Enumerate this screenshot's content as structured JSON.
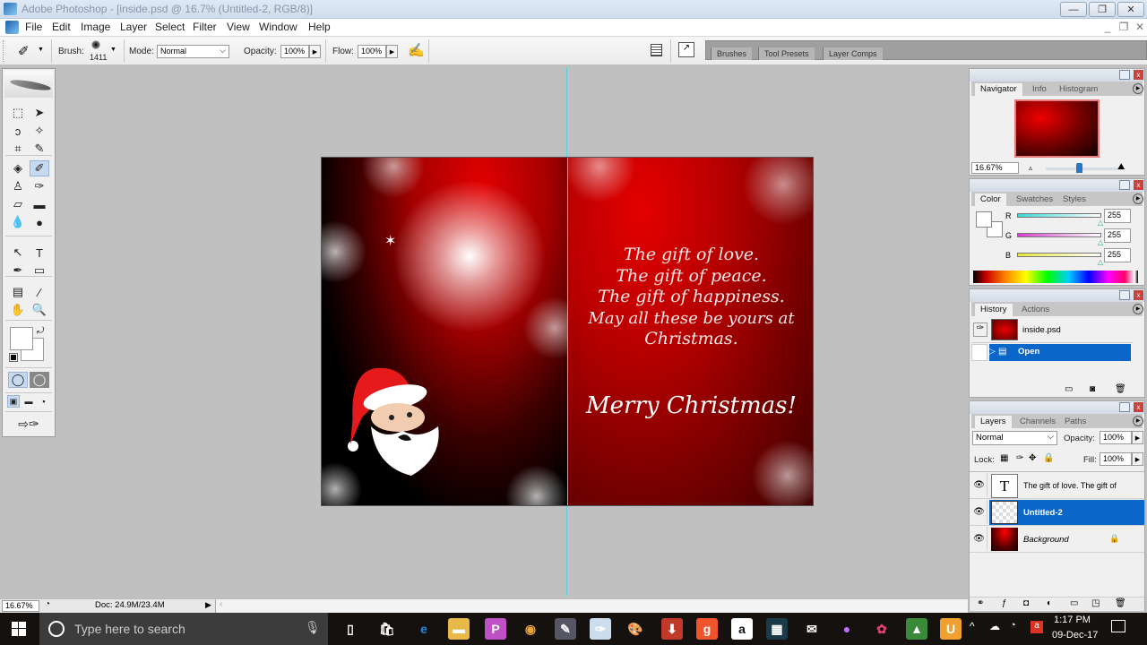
{
  "window": {
    "title": "Adobe Photoshop - [inside.psd @ 16.7% (Untitled-2, RGB/8)]",
    "minimize_glyph": "—",
    "restore_glyph": "❐",
    "close_glyph": "✕"
  },
  "menu": {
    "items": [
      "File",
      "Edit",
      "Image",
      "Layer",
      "Select",
      "Filter",
      "View",
      "Window",
      "Help"
    ],
    "doc_controls": [
      "_",
      "❐",
      "✕"
    ]
  },
  "options": {
    "brush_label": "Brush:",
    "brush_size": "1411",
    "mode_label": "Mode:",
    "mode_value": "Normal",
    "opacity_label": "Opacity:",
    "opacity_value": "100%",
    "flow_label": "Flow:",
    "flow_value": "100%",
    "well_tabs": [
      "Brushes",
      "Tool Presets",
      "Layer Comps"
    ]
  },
  "toolbox": {
    "tools": [
      {
        "name": "marquee-tool",
        "glyph": "⬚"
      },
      {
        "name": "move-tool",
        "glyph": "➤"
      },
      {
        "name": "lasso-tool",
        "glyph": "ↄ"
      },
      {
        "name": "magic-wand-tool",
        "glyph": "✧"
      },
      {
        "name": "crop-tool",
        "glyph": "⌗"
      },
      {
        "name": "slice-tool",
        "glyph": "✎"
      },
      {
        "name": "healing-brush-tool",
        "glyph": "◈"
      },
      {
        "name": "brush-tool",
        "glyph": "✐"
      },
      {
        "name": "clone-stamp-tool",
        "glyph": "♙"
      },
      {
        "name": "history-brush-tool",
        "glyph": "✑"
      },
      {
        "name": "eraser-tool",
        "glyph": "▱"
      },
      {
        "name": "gradient-tool",
        "glyph": "▬"
      },
      {
        "name": "blur-tool",
        "glyph": "💧"
      },
      {
        "name": "dodge-tool",
        "glyph": "●"
      },
      {
        "name": "path-selection-tool",
        "glyph": "↖"
      },
      {
        "name": "type-tool",
        "glyph": "T"
      },
      {
        "name": "pen-tool",
        "glyph": "✒"
      },
      {
        "name": "shape-tool",
        "glyph": "▭"
      },
      {
        "name": "notes-tool",
        "glyph": "▤"
      },
      {
        "name": "eyedropper-tool",
        "glyph": "⁄"
      },
      {
        "name": "hand-tool",
        "glyph": "✋"
      },
      {
        "name": "zoom-tool",
        "glyph": "🔍"
      }
    ]
  },
  "document": {
    "poem_lines": [
      "The gift of love.",
      "The gift of peace.",
      "The gift of happiness.",
      "May all these be yours at",
      "Christmas."
    ],
    "greeting": "Merry Christmas!"
  },
  "navigator": {
    "tabs": [
      "Navigator",
      "Info",
      "Histogram"
    ],
    "zoom_value": "16.67%",
    "slider_position_fraction": 0.4
  },
  "color": {
    "tabs": [
      "Color",
      "Swatches",
      "Styles"
    ],
    "channels": [
      {
        "label": "R",
        "value": "255",
        "color": "#3fd6d6"
      },
      {
        "label": "G",
        "value": "255",
        "color": "#d63fd0"
      },
      {
        "label": "B",
        "value": "255",
        "color": "#e6e63f"
      }
    ]
  },
  "history": {
    "tabs": [
      "History",
      "Actions"
    ],
    "snapshot": "inside.psd",
    "states": [
      {
        "label": "Open",
        "selected": true
      }
    ]
  },
  "layers": {
    "tabs": [
      "Layers",
      "Channels",
      "Paths"
    ],
    "blend_mode": "Normal",
    "opacity_label": "Opacity:",
    "opacity_value": "100%",
    "lock_label": "Lock:",
    "fill_label": "Fill:",
    "fill_value": "100%",
    "items": [
      {
        "name": "The gift of love. The gift of",
        "type": "text",
        "visible": true,
        "selected": false,
        "locked": false
      },
      {
        "name": "Untitled-2",
        "type": "pixel",
        "visible": true,
        "selected": true,
        "locked": false
      },
      {
        "name": "Background",
        "type": "background",
        "visible": true,
        "selected": false,
        "locked": true
      }
    ]
  },
  "statusbar": {
    "zoom": "16.67%",
    "doc_size": "Doc: 24.9M/23.4M"
  },
  "taskbar": {
    "search_placeholder": "Type here to search",
    "time": "1:17 PM",
    "date": "09-Dec-17",
    "apps": [
      {
        "name": "task-view",
        "glyph": "▯",
        "bg": "transparent"
      },
      {
        "name": "store",
        "glyph": "🛍",
        "bg": "transparent"
      },
      {
        "name": "edge",
        "glyph": "e",
        "bg": "transparent",
        "color": "#1e88e5"
      },
      {
        "name": "file-explorer",
        "glyph": "▬",
        "bg": "#e8b94a"
      },
      {
        "name": "picsart",
        "glyph": "P",
        "bg": "#c050c8"
      },
      {
        "name": "chrome",
        "glyph": "◉",
        "bg": "transparent",
        "color": "#e8a33b"
      },
      {
        "name": "app-pen",
        "glyph": "✎",
        "bg": "#556"
      },
      {
        "name": "photoshop",
        "glyph": "✑",
        "bg": "#cde"
      },
      {
        "name": "paint",
        "glyph": "🎨",
        "bg": "transparent"
      },
      {
        "name": "downloader",
        "glyph": "⬇",
        "bg": "#c0392b"
      },
      {
        "name": "g-app",
        "glyph": "g",
        "bg": "#f0542d"
      },
      {
        "name": "amazon",
        "glyph": "a",
        "bg": "#fff",
        "color": "#111"
      },
      {
        "name": "video-editor",
        "glyph": "▦",
        "bg": "#1a3a4a"
      },
      {
        "name": "mail",
        "glyph": "✉",
        "bg": "transparent"
      },
      {
        "name": "balloon",
        "glyph": "●",
        "bg": "transparent",
        "color": "#c070ff"
      },
      {
        "name": "flower-app",
        "glyph": "✿",
        "bg": "transparent",
        "color": "#e04070"
      },
      {
        "name": "picture-app",
        "glyph": "▲",
        "bg": "#3a8a3a"
      },
      {
        "name": "uc-browser",
        "glyph": "U",
        "bg": "#f0a030"
      }
    ]
  }
}
